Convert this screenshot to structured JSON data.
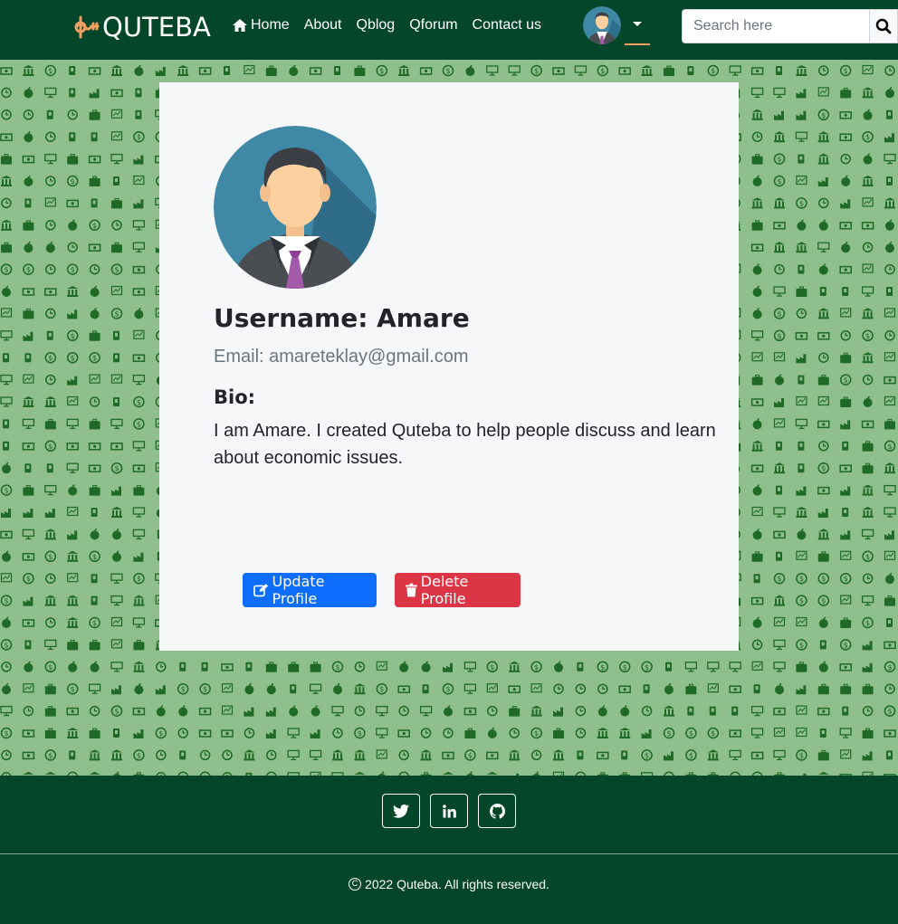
{
  "navbar": {
    "brand": "QUTEBA",
    "links": [
      "Home",
      "About",
      "Qblog",
      "Qforum",
      "Contact us"
    ],
    "search_placeholder": "Search here"
  },
  "profile": {
    "username": "Username: Amare",
    "email": "Email: amareteklay@gmail.com",
    "bio_label": "Bio:",
    "bio_text": "I am Amare. I created Quteba to help people discuss and learn about economic issues.",
    "update_label": "Update Profile",
    "delete_label": "Delete Profile"
  },
  "footer": {
    "social": [
      "twitter-icon",
      "linkedin-icon",
      "github-icon"
    ],
    "copyright": "2022 Quteba. All rights reserved."
  },
  "colors": {
    "nav_bg": "#04462a",
    "pattern_bg": "#8fbf8c",
    "pattern_icon": "#1f6a26",
    "brand_accent": "#f0a060",
    "primary": "#0d6efd",
    "danger": "#dc3545"
  }
}
